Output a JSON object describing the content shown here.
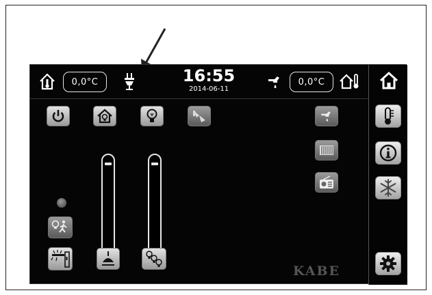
{
  "header": {
    "inside_temp": "0,0°C",
    "outside_temp": "0,0°C",
    "time": "16:55",
    "date": "2014-06-11"
  },
  "brand": {
    "logo_text": "KABE"
  },
  "icons": {
    "inside_thermometer": "house-thermometer-icon",
    "power_plug": "power-plug-icon",
    "water_tap": "water-tap-icon",
    "outside_thermometer": "outside-thermometer-icon",
    "home": "home-icon",
    "thermometer": "thermometer-icon",
    "info": "info-icon",
    "snowflake": "snowflake-icon",
    "settings": "gear-icon",
    "power": "power-icon",
    "house_light": "house-light-icon",
    "bulb": "light-bulb-icon",
    "spotlight": "spotlight-icon",
    "radiator": "radiator-icon",
    "radio": "radio-icon",
    "motion_light": "motion-sensor-light-icon",
    "awning_light": "awning-light-icon",
    "ceiling_lamp": "ceiling-lamp-icon",
    "multi_bulb": "multi-bulb-icon"
  },
  "sliders": [
    {
      "name": "ceiling-lamp-dimmer",
      "level": 0.95
    },
    {
      "name": "multi-bulb-dimmer",
      "level": 0.95
    }
  ],
  "colors": {
    "screen_bg": "#050505",
    "button_light": "#e2e2e2",
    "button_dark": "#9a9a9a",
    "accent": "#ffffff"
  }
}
